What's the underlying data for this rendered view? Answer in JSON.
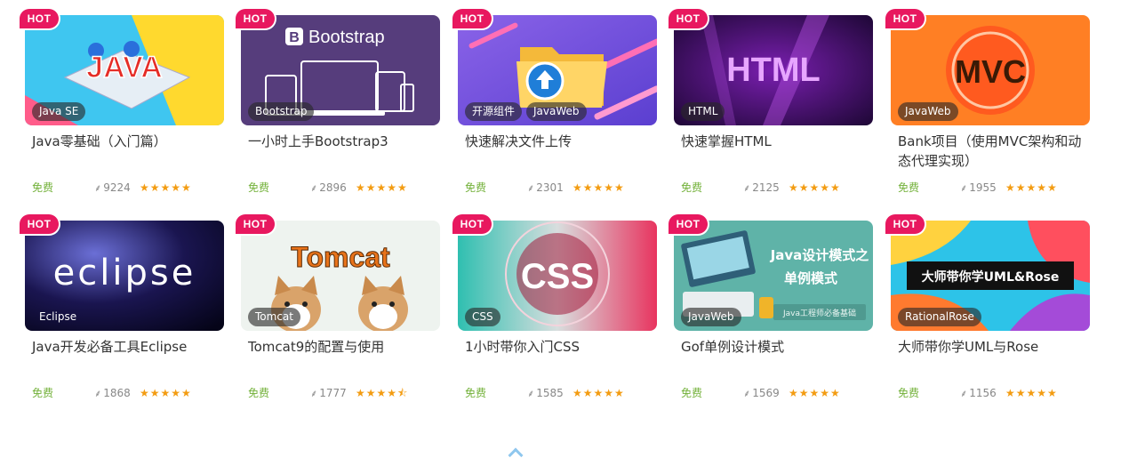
{
  "hot_label": "HOT",
  "courses": [
    {
      "title": "Java零基础（入门篇）",
      "tags": [
        "Java SE"
      ],
      "price": "免费",
      "learners": "9224",
      "rating_stars": 5,
      "art_text": "JAVA"
    },
    {
      "title": "一小时上手Bootstrap3",
      "tags": [
        "Bootstrap"
      ],
      "price": "免费",
      "learners": "2896",
      "rating_stars": 5,
      "art_text": "Bootstrap"
    },
    {
      "title": "快速解决文件上传",
      "tags": [
        "开源组件",
        "JavaWeb"
      ],
      "price": "免费",
      "learners": "2301",
      "rating_stars": 5,
      "art_text": ""
    },
    {
      "title": "快速掌握HTML",
      "tags": [
        "HTML"
      ],
      "price": "免费",
      "learners": "2125",
      "rating_stars": 5,
      "art_text": "HTML"
    },
    {
      "title": "Bank项目（使用MVC架构和动态代理实现）",
      "tags": [
        "JavaWeb"
      ],
      "price": "免费",
      "learners": "1955",
      "rating_stars": 5,
      "art_text": "MVC"
    },
    {
      "title": "Java开发必备工具Eclipse",
      "tags": [
        "Eclipse"
      ],
      "price": "免费",
      "learners": "1868",
      "rating_stars": 5,
      "art_text": "eclipse"
    },
    {
      "title": "Tomcat9的配置与使用",
      "tags": [
        "Tomcat"
      ],
      "price": "免费",
      "learners": "1777",
      "rating_stars": 4.5,
      "art_text": "Tomcat"
    },
    {
      "title": "1小时带你入门CSS",
      "tags": [
        "CSS"
      ],
      "price": "免费",
      "learners": "1585",
      "rating_stars": 5,
      "art_text": "CSS"
    },
    {
      "title": "Gof单例设计模式",
      "tags": [
        "JavaWeb"
      ],
      "price": "免费",
      "learners": "1569",
      "rating_stars": 5,
      "art_text": "Java设计模式之",
      "art_text2": "单例模式",
      "art_text3": "Java工程师必备基础"
    },
    {
      "title": "大师带你学UML与Rose",
      "tags": [
        "RationalRose"
      ],
      "price": "免费",
      "learners": "1156",
      "rating_stars": 5,
      "art_text": "大师带你学UML&Rose"
    }
  ]
}
